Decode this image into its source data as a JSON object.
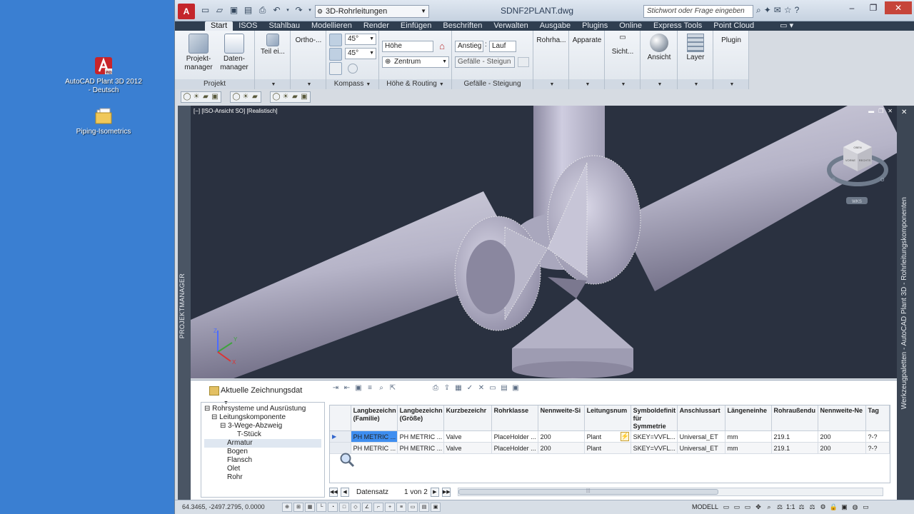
{
  "desktop": {
    "icons": [
      {
        "label": "AutoCAD Plant 3D 2012 - Deutsch"
      },
      {
        "label": "Piping-Isometrics"
      }
    ]
  },
  "titlebar": {
    "workspace": "3D-Rohrleitungen",
    "doc_title": "SDNF2PLANT.dwg",
    "search_placeholder": "Stichwort oder Frage eingeben"
  },
  "ribbon_tabs": [
    "Start",
    "ISOS",
    "Stahlbau",
    "Modellieren",
    "Render",
    "Einfügen",
    "Beschriften",
    "Verwalten",
    "Ausgabe",
    "Plugins",
    "Online",
    "Express Tools",
    "Point Cloud"
  ],
  "ribbon": {
    "projekt_manager": "Projekt-\nmanager",
    "daten_manager": "Daten-\nmanager",
    "projekt_title": "Projekt",
    "teil_ei": "Teil ei...",
    "ortho": "Ortho-...",
    "angle1": "45°",
    "angle2": "45°",
    "kompass_title": "Kompass",
    "hoehe": "Höhe",
    "zentrum": "Zentrum",
    "hoehe_title": "Höhe & Routing",
    "anstieg": "Anstieg",
    "lauf": "Lauf",
    "gefaelle": "Gefälle - Steigun",
    "gefaelle_title": "Gefälle - Steigung",
    "rohrha": "Rohrha...",
    "apparate": "Apparate",
    "sicht": "Sicht...",
    "ansicht": "Ansicht",
    "layer": "Layer",
    "plugin": "Plugin"
  },
  "viewport": {
    "label": "[−] [ISO-Ansicht SO] [Realistisch]",
    "cube_face_front": "VORNE",
    "cube_face_right": "RECHTS",
    "cube_face_top": "OBEN",
    "wks": "WKS"
  },
  "left_palette": "PROJEKTMANAGER",
  "right_palette": "Werkzeugpaletten - AutoCAD Plant 3D - Rohrleitungskomponenten",
  "project_manager": {
    "selector": "Aktuelle Zeichnungsdat",
    "tree": [
      {
        "label": "Rohrsysteme und Ausrüstung",
        "prefix": "⊟ "
      },
      {
        "label": "Leitungskomponente",
        "prefix": "⊟ "
      },
      {
        "label": "3-Wege-Abzweig",
        "prefix": "⊟ "
      },
      {
        "label": "T-Stück",
        "prefix": ""
      },
      {
        "label": "Armatur",
        "prefix": ""
      },
      {
        "label": "Bogen",
        "prefix": ""
      },
      {
        "label": "Flansch",
        "prefix": ""
      },
      {
        "label": "Olet",
        "prefix": ""
      },
      {
        "label": "Rohr",
        "prefix": ""
      }
    ],
    "columns": [
      "Langbezeichn (Familie)",
      "Langbezeichn (Größe)",
      "Kurzbezeichr",
      "Rohrklasse",
      "Nennweite-Si",
      "Leitungsnum",
      "Symboldefinit für Symmetrie",
      "Anschlussart",
      "Längeneinhe",
      "Rohraußendu",
      "Nennweite-Ne",
      "Tag"
    ],
    "rows": [
      [
        "PH METRIC ...",
        "PH METRIC ...",
        "Valve",
        "PlaceHolder ...",
        "200",
        "Plant",
        "SKEY=VVFL...",
        "Universal_ET",
        "mm",
        "219.1",
        "200",
        "?-?"
      ],
      [
        "PH METRIC ...",
        "PH METRIC ...",
        "Valve",
        "PlaceHolder ...",
        "200",
        "Plant",
        "SKEY=VVFL...",
        "Universal_ET",
        "mm",
        "219.1",
        "200",
        "?-?"
      ]
    ],
    "pager_label": "Datensatz",
    "pager_value": "1 von 2"
  },
  "statusbar": {
    "coords": "64.3465, -2497.2795, 0.0000",
    "modell": "MODELL",
    "scale": "1:1"
  },
  "colors": {
    "desktop": "#3a7fd2",
    "viewport_bg": "#2a3140",
    "tab_strip": "#2f3e50",
    "selection": "#3e8ef0"
  }
}
